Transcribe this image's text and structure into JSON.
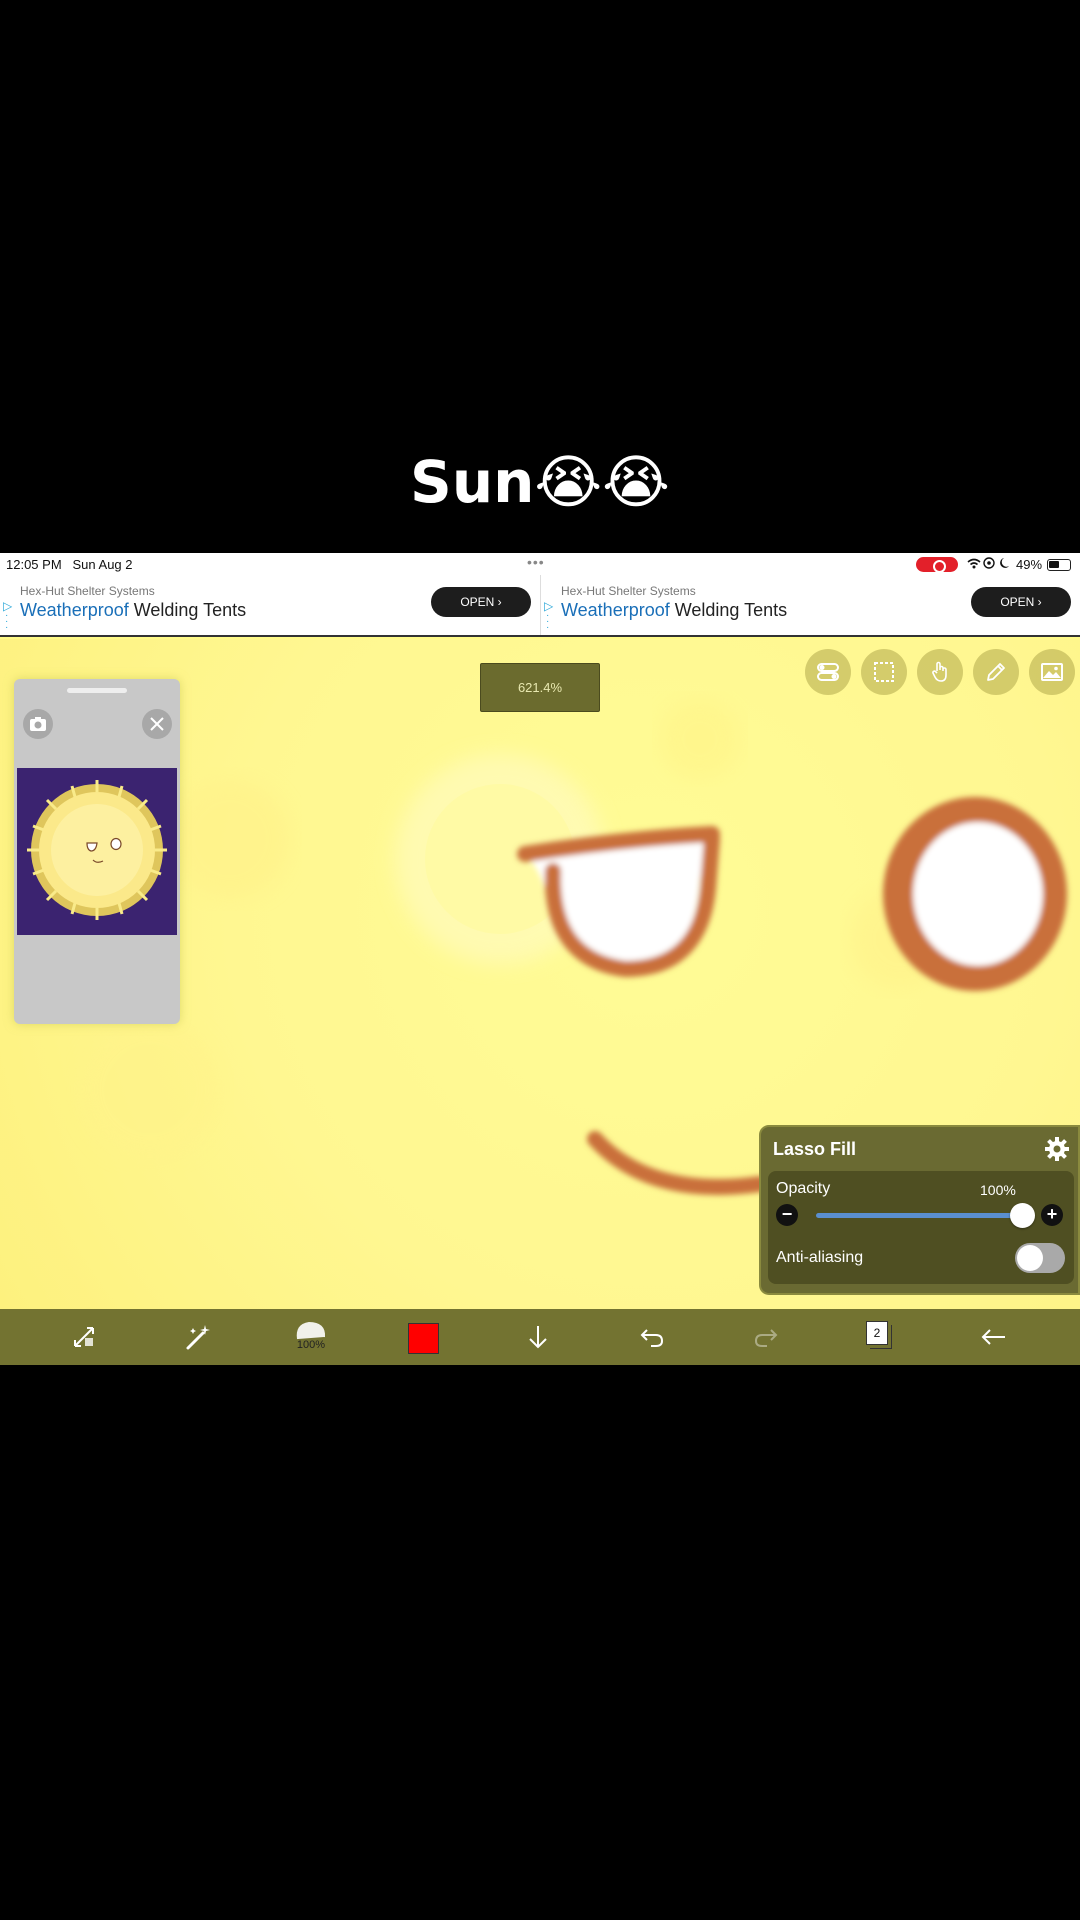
{
  "caption": "Sun😭😭",
  "status_bar": {
    "time": "12:05 PM",
    "date": "Sun Aug 2",
    "battery": "49%"
  },
  "ads": [
    {
      "sponsor": "Hex-Hut Shelter Systems",
      "headline_highlight": "Weatherproof",
      "headline_rest": " Welding Tents",
      "cta": "OPEN ›"
    },
    {
      "sponsor": "Hex-Hut Shelter Systems",
      "headline_highlight": "Weatherproof",
      "headline_rest": " Welding Tents",
      "cta": "OPEN ›"
    }
  ],
  "canvas": {
    "zoom": "621.4%"
  },
  "lasso_panel": {
    "title": "Lasso Fill",
    "opacity_label": "Opacity",
    "opacity_value": "100%",
    "opacity_level": 1.0,
    "antialias_label": "Anti-aliasing",
    "antialias_on": false
  },
  "bottom_toolbar": {
    "brush_size": "100%",
    "color": "#ff0000",
    "layer_count": "2"
  },
  "colors": {
    "toolbar_bg": "#737331",
    "canvas_bg": "#fff791",
    "panel_bg": "#6a6a32",
    "stroke": "#c9703a"
  }
}
